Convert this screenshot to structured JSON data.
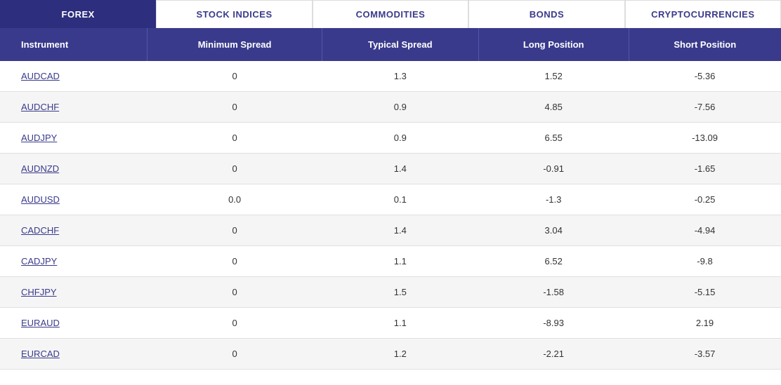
{
  "tabs": [
    {
      "id": "forex",
      "label": "FOREX",
      "active": true
    },
    {
      "id": "stock-indices",
      "label": "STOCK INDICES",
      "active": false
    },
    {
      "id": "commodities",
      "label": "COMMODITIES",
      "active": false
    },
    {
      "id": "bonds",
      "label": "BONDS",
      "active": false
    },
    {
      "id": "cryptocurrencies",
      "label": "CRYPTOCURRENCIES",
      "active": false
    }
  ],
  "columns": [
    {
      "id": "instrument",
      "label": "Instrument"
    },
    {
      "id": "min-spread",
      "label": "Minimum Spread"
    },
    {
      "id": "typical-spread",
      "label": "Typical Spread"
    },
    {
      "id": "long-position",
      "label": "Long Position"
    },
    {
      "id": "short-position",
      "label": "Short Position"
    }
  ],
  "rows": [
    {
      "instrument": "AUDCAD",
      "min_spread": "0",
      "typical_spread": "1.3",
      "long_position": "1.52",
      "short_position": "-5.36",
      "min_zero": true,
      "long_positive": true,
      "long_negative": false
    },
    {
      "instrument": "AUDCHF",
      "min_spread": "0",
      "typical_spread": "0.9",
      "long_position": "4.85",
      "short_position": "-7.56",
      "min_zero": true,
      "long_positive": true,
      "long_negative": false
    },
    {
      "instrument": "AUDJPY",
      "min_spread": "0",
      "typical_spread": "0.9",
      "long_position": "6.55",
      "short_position": "-13.09",
      "min_zero": true,
      "long_positive": true,
      "long_negative": false
    },
    {
      "instrument": "AUDNZD",
      "min_spread": "0",
      "typical_spread": "1.4",
      "long_position": "-0.91",
      "short_position": "-1.65",
      "min_zero": true,
      "long_positive": false,
      "long_negative": true
    },
    {
      "instrument": "AUDUSD",
      "min_spread": "0.0",
      "typical_spread": "0.1",
      "long_position": "-1.3",
      "short_position": "-0.25",
      "min_zero": true,
      "long_positive": false,
      "long_negative": true
    },
    {
      "instrument": "CADCHF",
      "min_spread": "0",
      "typical_spread": "1.4",
      "long_position": "3.04",
      "short_position": "-4.94",
      "min_zero": true,
      "long_positive": true,
      "long_negative": false
    },
    {
      "instrument": "CADJPY",
      "min_spread": "0",
      "typical_spread": "1.1",
      "long_position": "6.52",
      "short_position": "-9.8",
      "min_zero": true,
      "long_positive": true,
      "long_negative": false
    },
    {
      "instrument": "CHFJPY",
      "min_spread": "0",
      "typical_spread": "1.5",
      "long_position": "-1.58",
      "short_position": "-5.15",
      "min_zero": true,
      "long_positive": false,
      "long_negative": true
    },
    {
      "instrument": "EURAUD",
      "min_spread": "0",
      "typical_spread": "1.1",
      "long_position": "-8.93",
      "short_position": "2.19",
      "min_zero": true,
      "long_positive": false,
      "long_negative": true
    },
    {
      "instrument": "EURCAD",
      "min_spread": "0",
      "typical_spread": "1.2",
      "long_position": "-2.21",
      "short_position": "-3.57",
      "min_zero": true,
      "long_positive": false,
      "long_negative": true
    }
  ]
}
